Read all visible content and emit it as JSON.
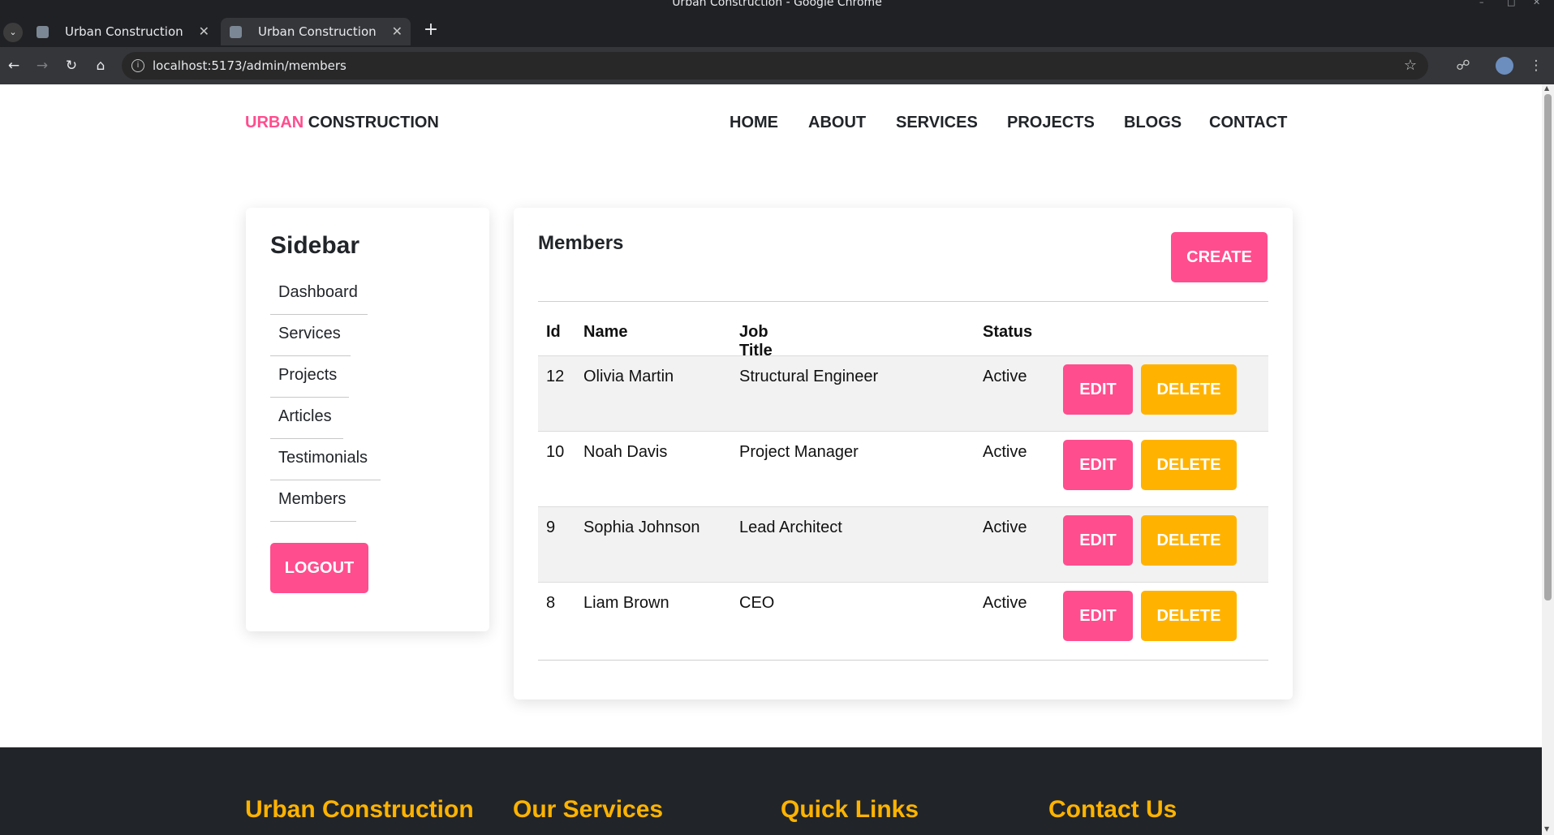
{
  "browser": {
    "window_title": "Urban Construction - Google Chrome",
    "tabs": [
      {
        "title": "Urban Construction"
      },
      {
        "title": "Urban Construction"
      }
    ],
    "url": "localhost:5173/admin/members"
  },
  "header": {
    "logo_accent": "URBAN",
    "logo_rest": " CONSTRUCTION",
    "nav": [
      "HOME",
      "ABOUT",
      "SERVICES",
      "PROJECTS",
      "BLOGS",
      "CONTACT"
    ]
  },
  "sidebar": {
    "title": "Sidebar",
    "items": [
      "Dashboard",
      "Services",
      "Projects",
      "Articles",
      "Testimonials",
      "Members"
    ],
    "logout_label": "LOGOUT"
  },
  "members": {
    "title": "Members",
    "create_label": "CREATE",
    "columns": [
      "Id",
      "Name",
      "Job Title",
      "Status"
    ],
    "edit_label": "EDIT",
    "delete_label": "DELETE",
    "rows": [
      {
        "id": "12",
        "name": "Olivia Martin",
        "job_title": "Structural Engineer",
        "status": "Active"
      },
      {
        "id": "10",
        "name": "Noah Davis",
        "job_title": "Project Manager",
        "status": "Active"
      },
      {
        "id": "9",
        "name": "Sophia Johnson",
        "job_title": "Lead Architect",
        "status": "Active"
      },
      {
        "id": "8",
        "name": "Liam Brown",
        "job_title": "CEO",
        "status": "Active"
      }
    ]
  },
  "footer": {
    "headings": [
      "Urban Construction",
      "Our Services",
      "Quick Links",
      "Contact Us"
    ]
  },
  "colors": {
    "accent_pink": "#ff4d8d",
    "accent_yellow": "#ffb300",
    "footer_bg": "#212529"
  }
}
